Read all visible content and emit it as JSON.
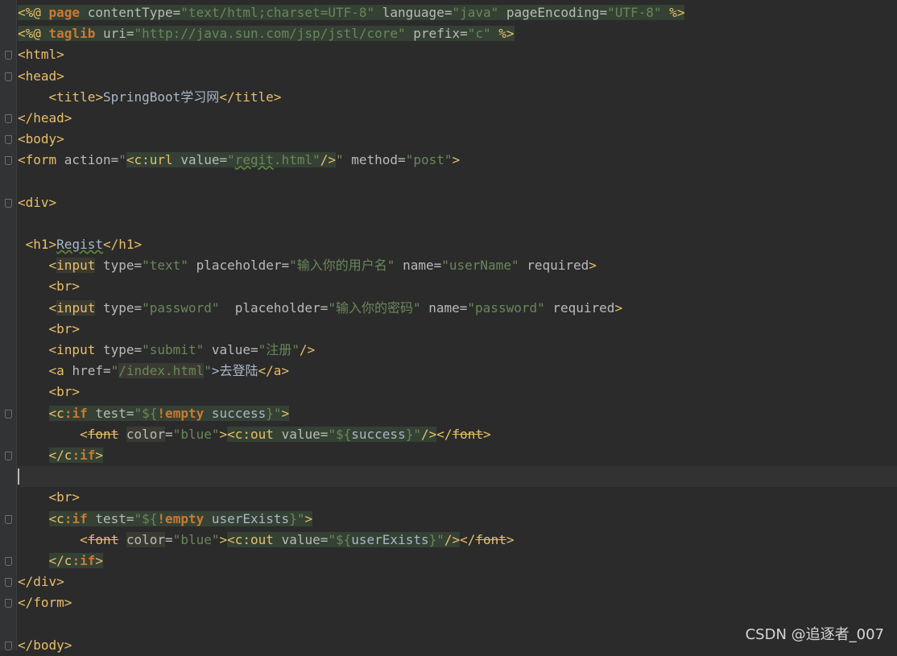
{
  "watermark": "CSDN @追逐者_007",
  "lines": {
    "l1": {
      "a": "<%@ ",
      "b": "page",
      "c": " contentType=",
      "d": "\"text/html;charset=UTF-8\"",
      "e": " language=",
      "f": "\"java\"",
      "g": " pageEncoding=",
      "h": "\"UTF-8\"",
      "i": " %>"
    },
    "l2": {
      "a": "<%@ ",
      "b": "taglib",
      "c": " uri=",
      "d": "\"http://java.sun.com/jsp/jstl/core\"",
      "e": " prefix=",
      "f": "\"c\"",
      "g": " %>"
    },
    "l3": {
      "a": "<html>"
    },
    "l4": {
      "a": "<head>"
    },
    "l5": {
      "indent": "    ",
      "a": "<title>",
      "b": "SpringBoot学习网",
      "c": "</title>"
    },
    "l6": {
      "a": "</head>"
    },
    "l7": {
      "a": "<body>"
    },
    "l8": {
      "a": "<form ",
      "b": "action=",
      "c": "\"",
      "d": "<c:url ",
      "e": "value=",
      "f": "\"",
      "g": "regit",
      ".h": "",
      "h": ".html\"",
      "i": "/>",
      "j": "\" ",
      "k": "method=",
      "l": "\"post\"",
      "m": ">"
    },
    "l10": {
      "a": "<div>"
    },
    "l12": {
      "indent": " ",
      "a": "<h1>",
      "b": "Regist",
      "c": "</h1>"
    },
    "l13": {
      "indent": "    ",
      "a": "<",
      "b": "input",
      "c": " type=",
      "d": "\"text\"",
      "e": " placeholder=",
      "f": "\"输入你的用户名\"",
      "g": " name=",
      "h": "\"userName\"",
      "i": " required",
      "j": ">"
    },
    "l14": {
      "indent": "    ",
      "a": "<br>"
    },
    "l15": {
      "indent": "    ",
      "a": "<",
      "b": "input",
      "c": " type=",
      "d": "\"password\"",
      "e": "  placeholder=",
      "f": "\"输入你的密码\"",
      "g": " name=",
      "h": "\"password\"",
      "i": " required",
      "j": ">"
    },
    "l16": {
      "indent": "    ",
      "a": "<br>"
    },
    "l17": {
      "indent": "    ",
      "a": "<input ",
      "b": "type=",
      "c": "\"submit\"",
      "d": " value=",
      "e": "\"注册\"",
      "f": "/>"
    },
    "l18": {
      "indent": "    ",
      "a": "<a ",
      "b": "href=",
      "c": "\"",
      "d": "/index.html",
      "e": "\"",
      "f": ">去登陆",
      "g": "</a>"
    },
    "l19": {
      "indent": "    ",
      "a": "<br>"
    },
    "l20": {
      "indent": "    ",
      "a": "<",
      "b": "c",
      "c": ":if",
      "d": " test=",
      "e": "\"${",
      "f": "!empty",
      "g": " success",
      "h": "}\"",
      "i": ">"
    },
    "l21": {
      "indent": "        ",
      "a": "<",
      "b": "font",
      "c": " ",
      "d": "color",
      "e": "=",
      "f": "\"blue\"",
      "g": ">",
      "h": "<c:out ",
      "i": "value=",
      "j": "\"${",
      "k": "success",
      "l": "}\"",
      "m": "/>",
      "n": "</",
      "o": "font",
      "p": ">"
    },
    "l22": {
      "indent": "    ",
      "a": "</",
      "b": "c",
      "c": ":if",
      ".d": "",
      "d": ">"
    },
    "l24": {
      "indent": "    ",
      "a": "<br>"
    },
    "l25": {
      "indent": "    ",
      "a": "<",
      "b": "c",
      "c": ":if",
      "d": " test=",
      "e": "\"${",
      "f": "!empty",
      "g": " userExists",
      "h": "}\"",
      "i": ">"
    },
    "l26": {
      "indent": "        ",
      "a": "<",
      "b": "font",
      "c": " ",
      "d": "color",
      "e": "=",
      "f": "\"blue\"",
      "g": ">",
      "h": "<c:out ",
      "i": "value=",
      "j": "\"${",
      "k": "userExists",
      "l": "}\"",
      "m": "/>",
      "n": "</",
      "o": "font",
      "p": ">"
    },
    "l27": {
      "indent": "    ",
      "a": "</",
      "b": "c",
      "c": ":if",
      "d": ">"
    },
    "l28": {
      "a": "</div>"
    },
    "l29": {
      "a": "</form>"
    },
    "l31": {
      "a": "</body>"
    }
  }
}
